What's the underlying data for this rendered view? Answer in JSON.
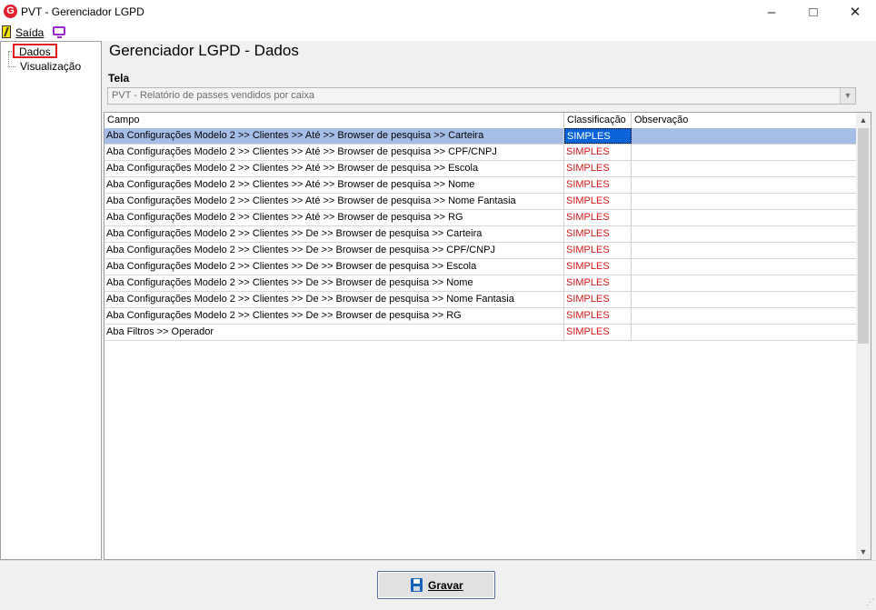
{
  "window": {
    "title": "PVT - Gerenciador LGPD",
    "minimize": "–",
    "maximize": "□",
    "close": "✕"
  },
  "menu": {
    "exit_label": "Saída"
  },
  "tree": {
    "items": [
      {
        "label": "Dados",
        "selected": true
      },
      {
        "label": "Visualização",
        "selected": false
      }
    ]
  },
  "page": {
    "title": "Gerenciador LGPD - Dados",
    "tela_label": "Tela",
    "tela_value": "PVT - Relatório de passes vendidos por caixa"
  },
  "grid": {
    "columns": [
      "Campo",
      "Classificação",
      "Observação"
    ],
    "rows": [
      {
        "campo": "Aba Configurações Modelo 2 >> Clientes >> Até >> Browser de pesquisa >> Carteira",
        "classificacao": "SIMPLES",
        "observacao": ""
      },
      {
        "campo": "Aba Configurações Modelo 2 >> Clientes >> Até >> Browser de pesquisa >> CPF/CNPJ",
        "classificacao": "SIMPLES",
        "observacao": ""
      },
      {
        "campo": "Aba Configurações Modelo 2 >> Clientes >> Até >> Browser de pesquisa >> Escola",
        "classificacao": "SIMPLES",
        "observacao": ""
      },
      {
        "campo": "Aba Configurações Modelo 2 >> Clientes >> Até >> Browser de pesquisa >> Nome",
        "classificacao": "SIMPLES",
        "observacao": ""
      },
      {
        "campo": "Aba Configurações Modelo 2 >> Clientes >> Até >> Browser de pesquisa >> Nome Fantasia",
        "classificacao": "SIMPLES",
        "observacao": ""
      },
      {
        "campo": "Aba Configurações Modelo 2 >> Clientes >> Até >> Browser de pesquisa >> RG",
        "classificacao": "SIMPLES",
        "observacao": ""
      },
      {
        "campo": "Aba Configurações Modelo 2 >> Clientes >> De >> Browser de pesquisa >> Carteira",
        "classificacao": "SIMPLES",
        "observacao": ""
      },
      {
        "campo": "Aba Configurações Modelo 2 >> Clientes >> De >> Browser de pesquisa >> CPF/CNPJ",
        "classificacao": "SIMPLES",
        "observacao": ""
      },
      {
        "campo": "Aba Configurações Modelo 2 >> Clientes >> De >> Browser de pesquisa >> Escola",
        "classificacao": "SIMPLES",
        "observacao": ""
      },
      {
        "campo": "Aba Configurações Modelo 2 >> Clientes >> De >> Browser de pesquisa >> Nome",
        "classificacao": "SIMPLES",
        "observacao": ""
      },
      {
        "campo": "Aba Configurações Modelo 2 >> Clientes >> De >> Browser de pesquisa >> Nome Fantasia",
        "classificacao": "SIMPLES",
        "observacao": ""
      },
      {
        "campo": "Aba Configurações Modelo 2 >> Clientes >> De >> Browser de pesquisa >> RG",
        "classificacao": "SIMPLES",
        "observacao": ""
      },
      {
        "campo": "Aba Filtros >> Operador",
        "classificacao": "SIMPLES",
        "observacao": ""
      }
    ]
  },
  "footer": {
    "save_label": "Gravar"
  },
  "colors": {
    "classification_text": "#d01818",
    "selected_row": "#a6bde8",
    "selected_cell": "#0a64d8",
    "app_icon": "#e0202e"
  },
  "icons": [
    "app-logo-icon",
    "exit-icon",
    "monitor-icon",
    "save-icon"
  ]
}
